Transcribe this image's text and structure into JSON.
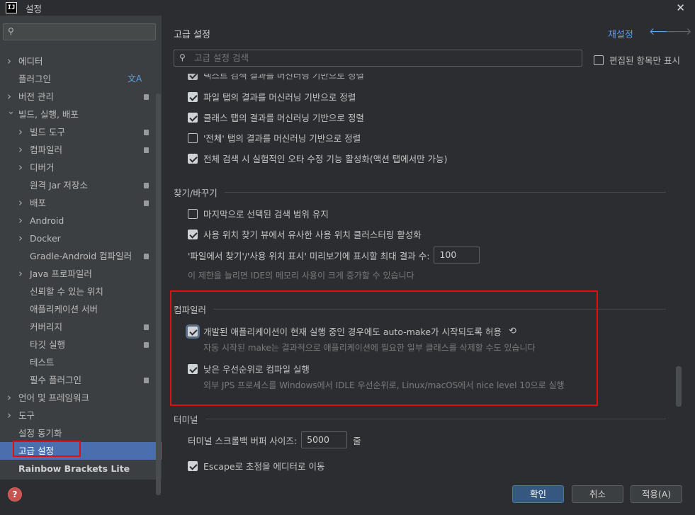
{
  "window": {
    "title": "설정",
    "app_icon": "IJ"
  },
  "sidebar": {
    "search_placeholder": "",
    "items": [
      {
        "label": "에디터",
        "expandable": true,
        "expanded": false,
        "level": 0
      },
      {
        "label": "플러그인",
        "expandable": false,
        "level": 0,
        "translate_icon": true
      },
      {
        "label": "버전 관리",
        "expandable": true,
        "expanded": false,
        "level": 0,
        "badge": true
      },
      {
        "label": "빌드, 실행, 배포",
        "expandable": true,
        "expanded": true,
        "level": 0
      },
      {
        "label": "빌드 도구",
        "expandable": true,
        "level": 1,
        "badge": true
      },
      {
        "label": "컴파일러",
        "expandable": true,
        "level": 1,
        "badge": true
      },
      {
        "label": "디버거",
        "expandable": true,
        "level": 1
      },
      {
        "label": "원격 Jar 저장소",
        "expandable": false,
        "level": 1,
        "badge": true
      },
      {
        "label": "배포",
        "expandable": true,
        "level": 1,
        "badge": true
      },
      {
        "label": "Android",
        "expandable": true,
        "level": 1
      },
      {
        "label": "Docker",
        "expandable": true,
        "level": 1
      },
      {
        "label": "Gradle-Android 컴파일러",
        "expandable": false,
        "level": 1,
        "badge": true
      },
      {
        "label": "Java 프로파일러",
        "expandable": true,
        "level": 1
      },
      {
        "label": "신뢰할 수 있는 위치",
        "expandable": false,
        "level": 1
      },
      {
        "label": "애플리케이션 서버",
        "expandable": false,
        "level": 1
      },
      {
        "label": "커버리지",
        "expandable": false,
        "level": 1,
        "badge": true
      },
      {
        "label": "타깃 실행",
        "expandable": false,
        "level": 1,
        "badge": true
      },
      {
        "label": "테스트",
        "expandable": false,
        "level": 1
      },
      {
        "label": "필수 플러그인",
        "expandable": false,
        "level": 1,
        "badge": true
      },
      {
        "label": "언어 및 프레임워크",
        "expandable": true,
        "expanded": false,
        "level": 0
      },
      {
        "label": "도구",
        "expandable": true,
        "expanded": false,
        "level": 0
      },
      {
        "label": "설정 동기화",
        "expandable": false,
        "level": 0
      },
      {
        "label": "고급 설정",
        "expandable": false,
        "level": 0,
        "selected": true
      },
      {
        "label": "Rainbow Brackets Lite",
        "expandable": false,
        "level": 0,
        "bold": true
      }
    ]
  },
  "main": {
    "title": "고급 설정",
    "reset_label": "재설정",
    "search_placeholder": "고급 설정 검색",
    "edited_only_label": "편집된 항목만 표시",
    "clipped_top_row": "텍스트 검색 결과를 머신러닝 기반으로 정렬",
    "search_ranking": [
      {
        "label": "파일 탭의 결과를 머신러닝 기반으로 정렬",
        "checked": true
      },
      {
        "label": "클래스 탭의 결과를 머신러닝 기반으로 정렬",
        "checked": true
      },
      {
        "label": "'전체' 탭의 결과를 머신러닝 기반으로 정렬",
        "checked": false
      },
      {
        "label": "전체 검색 시 실험적인 오타 수정 기능 활성화(액션 탭에서만 가능)",
        "checked": true
      }
    ],
    "find_replace": {
      "title": "찾기/바꾸기",
      "keep_scope_label": "마지막으로 선택된 검색 범위 유지",
      "keep_scope_checked": false,
      "cluster_label": "사용 위치 찾기 뷰에서 유사한 사용 위치 클러스터링 활성화",
      "cluster_checked": true,
      "max_results_label": "'파일에서 찾기'/'사용 위치 표시' 미리보기에 표시할 최대 결과 수:",
      "max_results_value": "100",
      "max_results_hint": "이 제한을 늘리면 IDE의 메모리 사용이 크게 증가할 수 있습니다"
    },
    "compiler": {
      "title": "컴파일러",
      "automake_label": "개발된 애플리케이션이 현재 실행 중인 경우에도 auto-make가 시작되도록 허용",
      "automake_checked": true,
      "automake_hint": "자동 시작된 make는 결과적으로 애플리케이션에 필요한 일부 클래스를 삭제할 수도 있습니다",
      "low_priority_label": "낮은 우선순위로 컴파일 실행",
      "low_priority_checked": true,
      "low_priority_hint": "외부 JPS 프로세스를 Windows에서 IDLE 우선순위로, Linux/macOS에서 nice level 10으로 실행"
    },
    "terminal": {
      "title": "터미널",
      "scrollback_label": "터미널 스크롤백 버퍼 사이즈:",
      "scrollback_value": "5000",
      "scrollback_unit": "줄",
      "clipped_bottom_row": "Escape로 초점을 에디터로 이동"
    }
  },
  "footer": {
    "ok": "확인",
    "cancel": "취소",
    "apply": "적용(A)"
  },
  "colors": {
    "selection": "#4b6eaf",
    "highlight_box": "#e01010",
    "link": "#589df6"
  }
}
